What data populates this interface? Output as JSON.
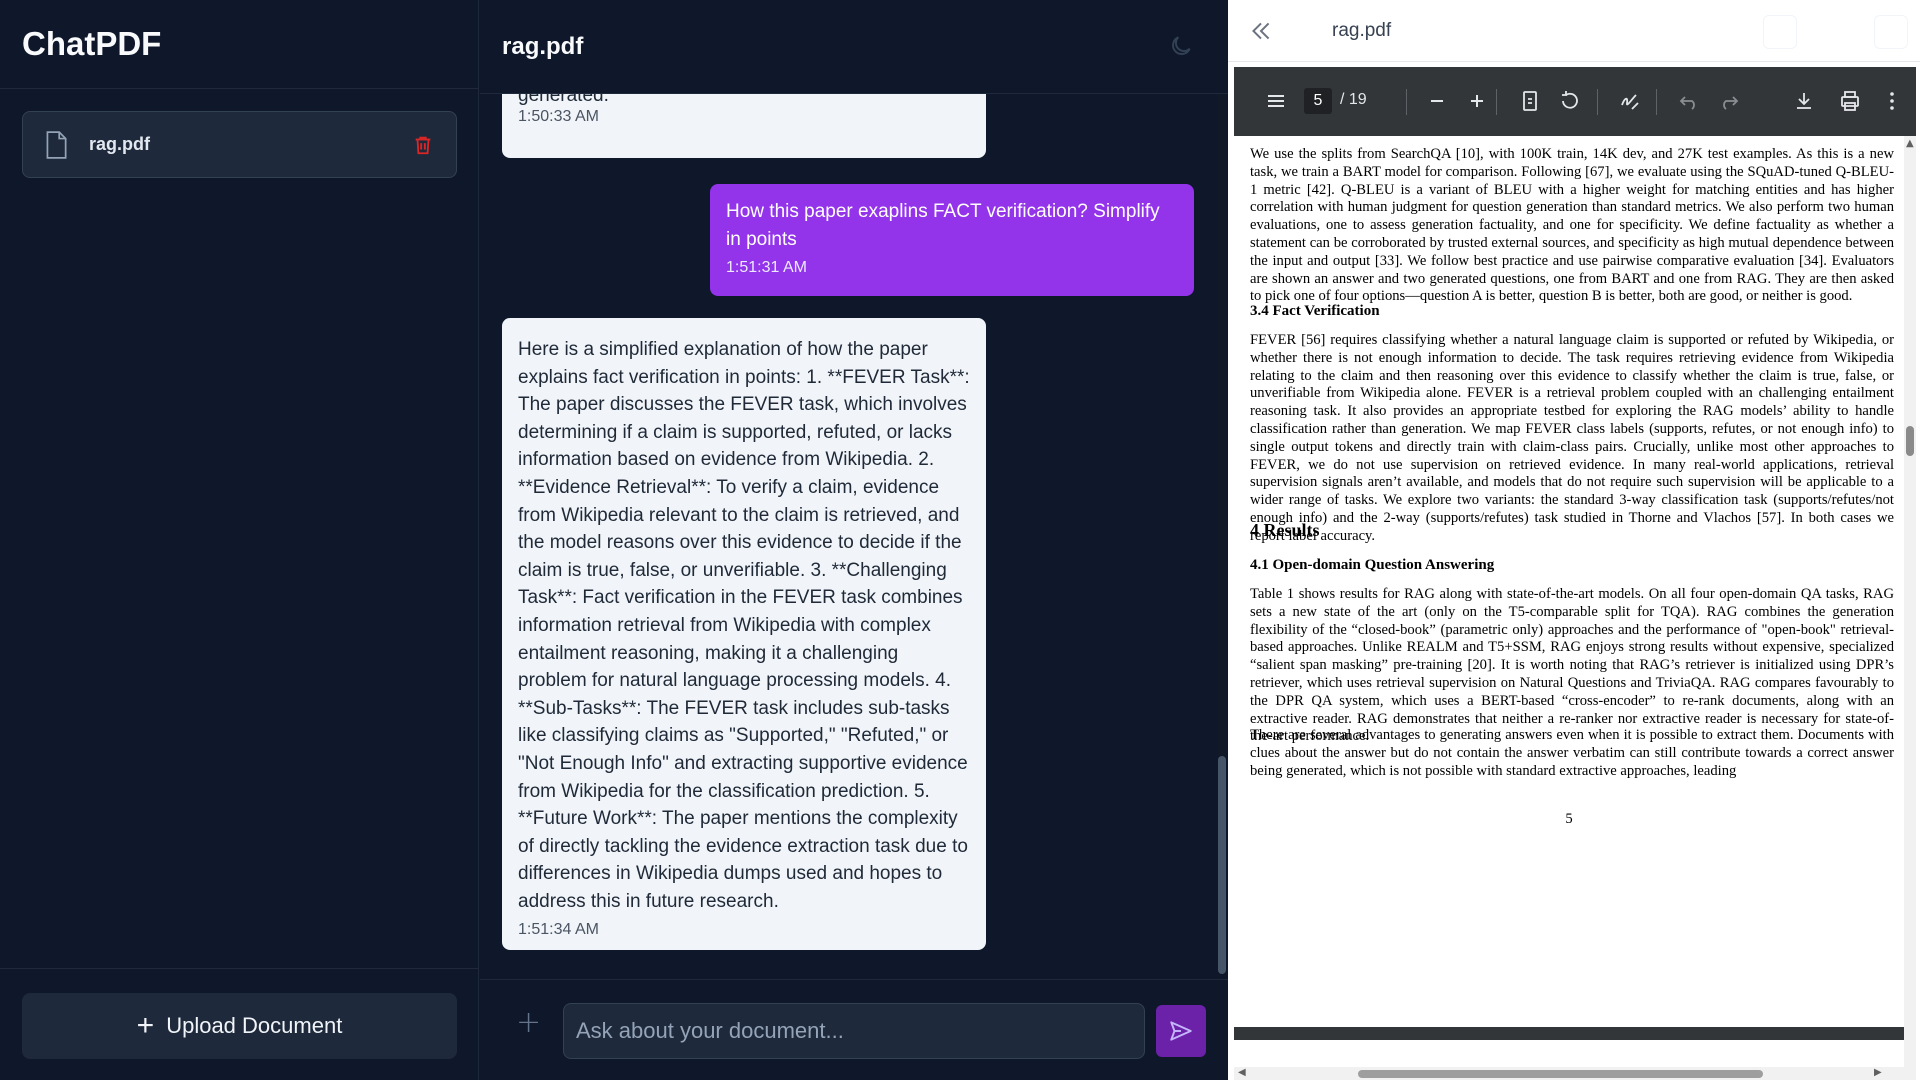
{
  "sidebar": {
    "brand": "ChatPDF",
    "documents": [
      {
        "name": "rag.pdf"
      }
    ],
    "upload_label": "Upload Document"
  },
  "chat": {
    "title": "rag.pdf",
    "messages": [
      {
        "role": "ai",
        "text": "generated.",
        "time": "1:50:33 AM"
      },
      {
        "role": "user",
        "text": "How this paper exaplins FACT verification? Simplify in points",
        "time": "1:51:31 AM"
      },
      {
        "role": "ai",
        "text": "Here is a simplified explanation of how the paper explains fact verification in points: 1. **FEVER Task**: The paper discusses the FEVER task, which involves determining if a claim is supported, refuted, or lacks information based on evidence from Wikipedia. 2. **Evidence Retrieval**: To verify a claim, evidence from Wikipedia relevant to the claim is retrieved, and the model reasons over this evidence to decide if the claim is true, false, or unverifiable. 3. **Challenging Task**: Fact verification in the FEVER task combines information retrieval from Wikipedia with complex entailment reasoning, making it a challenging problem for natural language processing models. 4. **Sub-Tasks**: The FEVER task includes sub-tasks like classifying claims as \"Supported,\" \"Refuted,\" or \"Not Enough Info\" and extracting supportive evidence from Wikipedia for the classification prediction. 5. **Future Work**: The paper mentions the complexity of directly tackling the evidence extraction task due to differences in Wikipedia dumps used and hopes to address this in future research.",
        "time": "1:51:34 AM"
      }
    ],
    "composer_placeholder": "Ask about your document..."
  },
  "pdf": {
    "title": "rag.pdf",
    "page_current": "5",
    "page_total": "/ 19",
    "content": {
      "p1": "We use the splits from SearchQA [10], with 100K train, 14K dev, and 27K test examples. As this is a new task, we train a BART model for comparison. Following [67], we evaluate using the SQuAD-tuned Q-BLEU-1 metric [42]. Q-BLEU is a variant of BLEU with a higher weight for matching entities and has higher correlation with human judgment for question generation than standard metrics. We also perform two human evaluations, one to assess generation factuality, and one for specificity. We define factuality as whether a statement can be corroborated by trusted external sources, and specificity as high mutual dependence between the input and output [33]. We follow best practice and use pairwise comparative evaluation [34]. Evaluators are shown an answer and two generated questions, one from BART and one from RAG. They are then asked to pick one of four options—question A is better, question B is better, both are good, or neither is good.",
      "s34": "3.4   Fact Verification",
      "p2": "FEVER [56] requires classifying whether a natural language claim is supported or refuted by Wikipedia, or whether there is not enough information to decide. The task requires retrieving evidence from Wikipedia relating to the claim and then reasoning over this evidence to classify whether the claim is true, false, or unverifiable from Wikipedia alone. FEVER is a retrieval problem coupled with an challenging entailment reasoning task. It also provides an appropriate testbed for exploring the RAG models’ ability to handle classification rather than generation. We map FEVER class labels (supports, refutes, or not enough info) to single output tokens and directly train with claim-class pairs. Crucially, unlike most other approaches to FEVER, we do not use supervision on retrieved evidence. In many real-world applications, retrieval supervision signals aren’t available, and models that do not require such supervision will be applicable to a wider range of tasks. We explore two variants: the standard 3-way classification task (supports/refutes/not enough info) and the 2-way (supports/refutes) task studied in Thorne and Vlachos [57]. In both cases we report label accuracy.",
      "s4": "4    Results",
      "s41": "4.1   Open-domain Question Answering",
      "p3": "Table 1 shows results for RAG along with state-of-the-art models. On all four open-domain QA tasks, RAG sets a new state of the art (only on the T5-comparable split for TQA). RAG combines the generation flexibility of the “closed-book” (parametric only) approaches and the performance of \"open-book\" retrieval-based approaches. Unlike REALM and T5+SSM, RAG enjoys strong results without expensive, specialized “salient span masking” pre-training [20]. It is worth noting that RAG’s retriever is initialized using DPR’s retriever, which uses retrieval supervision on Natural Questions and TriviaQA. RAG compares favourably to the DPR QA system, which uses a BERT-based “cross-encoder” to re-rank documents, along with an extractive reader. RAG demonstrates that neither a re-ranker nor extractive reader is necessary for state-of-the-art performance.",
      "p4": "There are several advantages to generating answers even when it is possible to extract them. Documents with clues about the answer but do not contain the answer verbatim can still contribute towards a correct answer being generated, which is not possible with standard extractive approaches, leading",
      "page_number": "5"
    }
  },
  "icons": [
    "file-icon",
    "trash-icon",
    "plus-icon",
    "moon-icon",
    "send-icon",
    "double-chevron-left-icon",
    "menu-icon",
    "zoom-out-icon",
    "zoom-in-icon",
    "fit-page-icon",
    "rotate-icon",
    "draw-icon",
    "undo-icon",
    "redo-icon",
    "download-icon",
    "print-icon",
    "more-icon"
  ],
  "colors": {
    "background": "#0f172a",
    "user_bubble": "#9333ea",
    "send_button": "#6b21a8",
    "ai_bubble": "#f1f5f9"
  }
}
